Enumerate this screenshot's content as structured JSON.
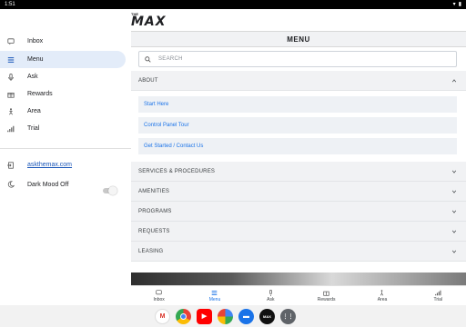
{
  "status": {
    "time": "1:51"
  },
  "brand": {
    "small": "THE",
    "name": "MAX"
  },
  "sidebar": {
    "items": [
      {
        "label": "Inbox",
        "icon": "chat-icon"
      },
      {
        "label": "Menu",
        "icon": "menu-icon"
      },
      {
        "label": "Ask",
        "icon": "mic-icon"
      },
      {
        "label": "Rewards",
        "icon": "gift-icon"
      },
      {
        "label": "Area",
        "icon": "walk-icon"
      },
      {
        "label": "Trial",
        "icon": "signal-icon"
      }
    ],
    "link": "askthemax.com",
    "dark_mode_label": "Dark Mood Off"
  },
  "main": {
    "header": "MENU",
    "search_placeholder": "SEARCH",
    "about": "ABOUT",
    "about_items": [
      "Start Here",
      "Control Panel Tour",
      "Get Started / Contact Us"
    ],
    "sections": [
      "SERVICES & PROCEDURES",
      "AMENITIES",
      "PROGRAMS",
      "REQUESTS",
      "LEASING"
    ]
  },
  "bottom_nav": [
    "Inbox",
    "Menu",
    "Ask",
    "Rewards",
    "Area",
    "Trial"
  ],
  "colors": {
    "accent": "#1a73e8",
    "active_bg": "#e3ecf9",
    "section_bg": "#f1f2f4"
  }
}
